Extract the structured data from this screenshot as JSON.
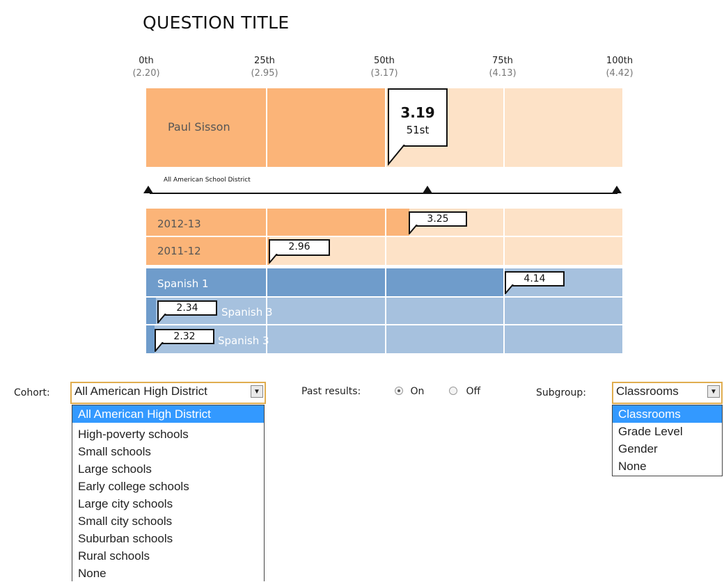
{
  "title": "QUESTION TITLE",
  "ticks": [
    {
      "pct": "0th",
      "value": "(2.20)"
    },
    {
      "pct": "25th",
      "value": "(2.95)"
    },
    {
      "pct": "50th",
      "value": "(3.17)"
    },
    {
      "pct": "75th",
      "value": "(4.13)"
    },
    {
      "pct": "100th",
      "value": "(4.42)"
    }
  ],
  "main_row": {
    "label": "Paul Sisson",
    "score": "3.19",
    "percentile": "51st"
  },
  "district_label": "All American School District",
  "past_rows": [
    {
      "label": "2012-13",
      "score": "3.25"
    },
    {
      "label": "2011-12",
      "score": "2.96"
    }
  ],
  "subgroup_rows": [
    {
      "label": "Spanish 1",
      "score": "4.14"
    },
    {
      "label": "Spanish 3",
      "score": "2.34"
    },
    {
      "label": "Spanish 3",
      "score": "2.32"
    }
  ],
  "controls": {
    "cohort_label": "Cohort:",
    "cohort_value": "All American High District",
    "cohort_options": [
      "All American High District",
      "High-poverty schools",
      "Small schools",
      "Large schools",
      "Early college schools",
      "Large city schools",
      "Small city schools",
      "Suburban schools",
      "Rural schools",
      "None"
    ],
    "past_label": "Past results:",
    "past_on": "On",
    "past_off": "Off",
    "past_selected": "On",
    "subgroup_label": "Subgroup:",
    "subgroup_value": "Classrooms",
    "subgroup_options": [
      "Classrooms",
      "Grade Level",
      "Gender",
      "None"
    ]
  },
  "colors": {
    "orange_dark": "#fbb478",
    "orange_light": "#fde2c7",
    "blue_dark": "#6f9ccb",
    "blue_light": "#a6c1de",
    "select_border": "#e0ad4f",
    "highlight": "#3399ff"
  },
  "icons": {
    "dropdown": "chevron-down-icon",
    "marker": "triangle-up-icon"
  }
}
